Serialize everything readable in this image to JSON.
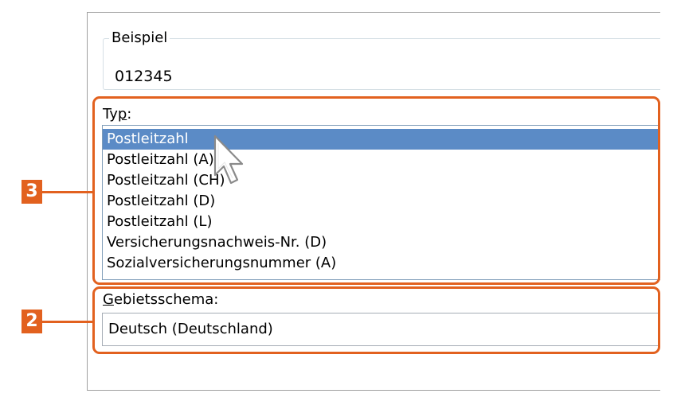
{
  "example_group": {
    "legend": "Beispiel",
    "value": "012345"
  },
  "type_section": {
    "label_pre": "Ty",
    "label_accel": "p",
    "label_post": ":",
    "items": [
      {
        "label": "Postleitzahl",
        "selected": true
      },
      {
        "label": "Postleitzahl (A)",
        "selected": false
      },
      {
        "label": "Postleitzahl (CH)",
        "selected": false
      },
      {
        "label": "Postleitzahl (D)",
        "selected": false
      },
      {
        "label": "Postleitzahl (L)",
        "selected": false
      },
      {
        "label": "Versicherungsnachweis-Nr. (D)",
        "selected": false
      },
      {
        "label": "Sozialversicherungsnummer (A)",
        "selected": false
      }
    ]
  },
  "locale_section": {
    "label_accel": "G",
    "label_rest": "ebietsschema:",
    "value": "Deutsch (Deutschland)"
  },
  "callouts": [
    {
      "number": "3",
      "target": "type-listbox"
    },
    {
      "number": "2",
      "target": "locale-combobox"
    }
  ],
  "colors": {
    "accent": "#e2611f",
    "selection": "#5b8bc6"
  }
}
